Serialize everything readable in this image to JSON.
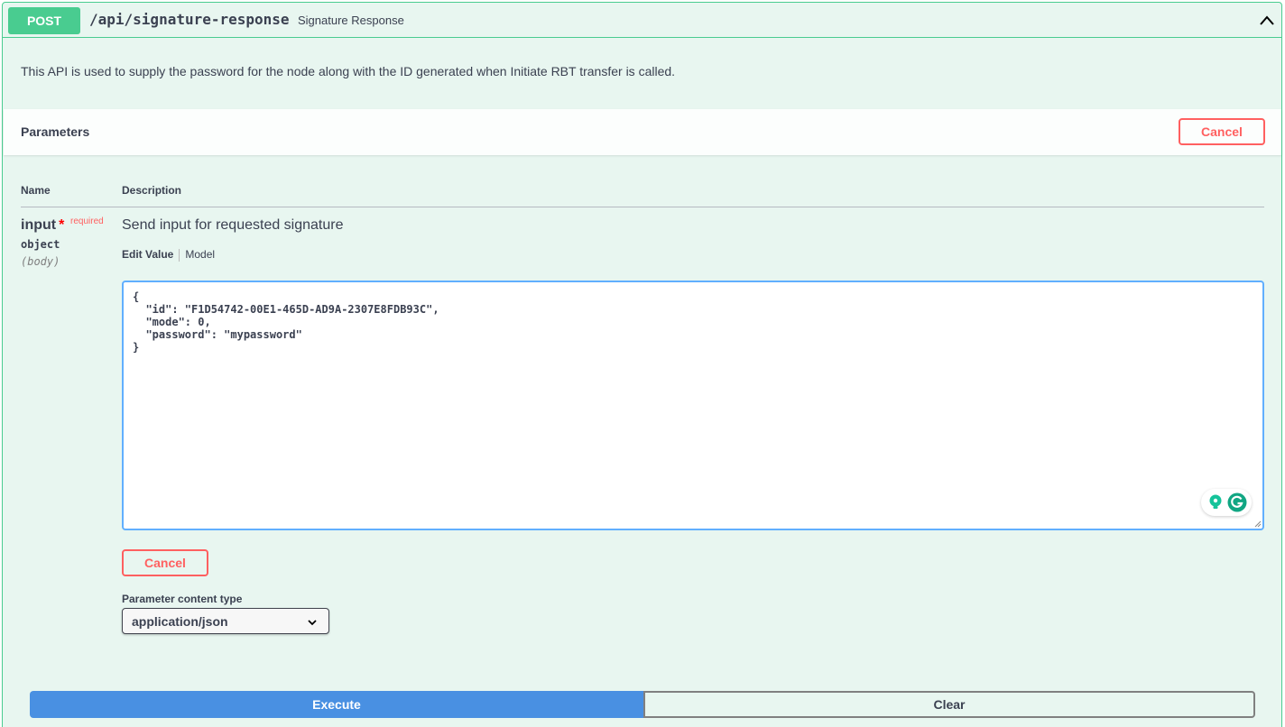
{
  "operation": {
    "method": "POST",
    "path": "/api/signature-response",
    "summary": "Signature Response",
    "description": "This API is used to supply the password for the node along with the ID generated when Initiate RBT transfer is called."
  },
  "parameters_section": {
    "title": "Parameters",
    "cancel_label": "Cancel",
    "columns": {
      "name": "Name",
      "description": "Description"
    }
  },
  "param": {
    "name": "input",
    "required_marker": "*",
    "required_label": "required",
    "type": "object",
    "in": "(body)",
    "description": "Send input for requested signature",
    "tabs": [
      "Edit Value",
      "Model"
    ],
    "editor_value": "{\n  \"id\": \"F1D54742-00E1-465D-AD9A-2307E8FDB93C\",\n  \"mode\": 0,\n  \"password\": \"mypassword\"\n}",
    "cancel_label": "Cancel"
  },
  "content_type": {
    "label": "Parameter content type",
    "selected": "application/json"
  },
  "actions": {
    "execute": "Execute",
    "clear": "Clear"
  },
  "colors": {
    "post": "#49cc90",
    "cancel": "#ff6060",
    "execute": "#4990e2",
    "editor_border": "#61affe"
  },
  "icons": {
    "collapse": "chevron-up-icon",
    "select_arrow": "chevron-down-icon",
    "grammarly_bulb": "bulb-icon",
    "grammarly_logo": "grammarly-icon"
  }
}
